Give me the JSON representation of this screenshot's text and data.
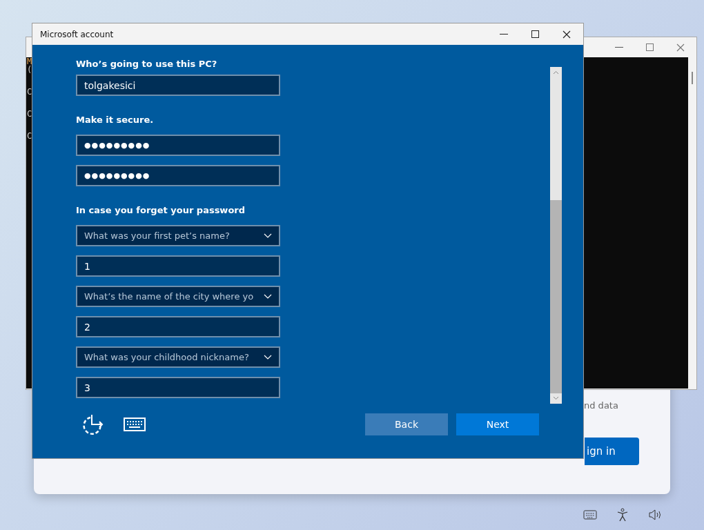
{
  "background_windows": {
    "console": {
      "lines": [
        "M",
        "(",
        "C",
        "C",
        "C"
      ]
    },
    "sign_in": {
      "text": "nd data",
      "button": "ign in"
    }
  },
  "window": {
    "title": "Microsoft account"
  },
  "form": {
    "heading": "Who’s going to use this PC?",
    "username": "tolgakesici",
    "secure_heading": "Make it secure.",
    "passwords": [
      "●●●●●●●●●",
      "●●●●●●●●●"
    ],
    "recovery_heading": "In case you forget your password",
    "questions": [
      {
        "question": "What was your first pet’s name?",
        "answer": "1"
      },
      {
        "question": "What’s the name of the city where yo",
        "answer": "2"
      },
      {
        "question": "What was your childhood nickname?",
        "answer": "3"
      }
    ]
  },
  "buttons": [
    {
      "label": "Back",
      "kind": "secondary"
    },
    {
      "label": "Next",
      "kind": "primary"
    }
  ]
}
